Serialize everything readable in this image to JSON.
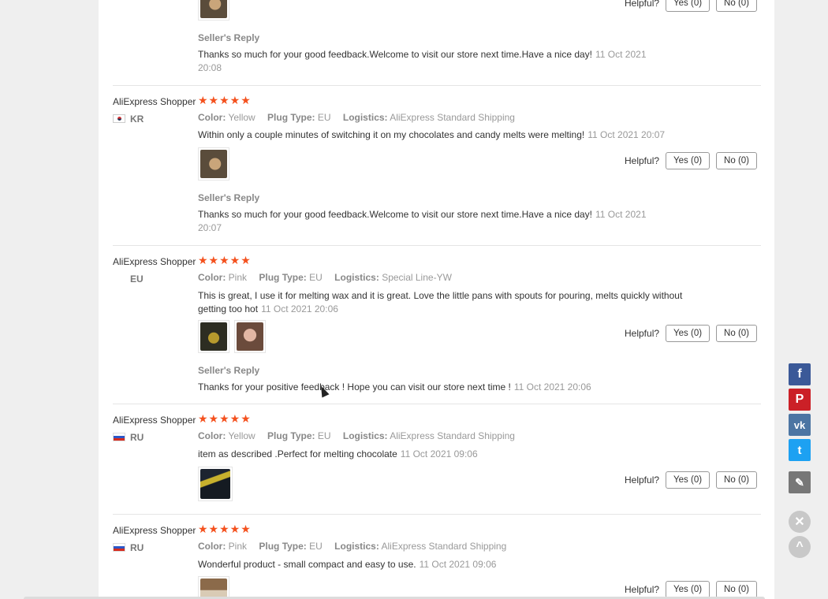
{
  "top_partial": {
    "helpful_label": "Helpful?",
    "yes_label": "Yes (0)",
    "no_label": "No (0)",
    "seller_title": "Seller's Reply",
    "seller_text": "Thanks so much for your good feedback.Welcome to visit our store next time.Have a nice day!",
    "seller_date": "11 Oct 2021 20:08"
  },
  "feedbacks": [
    {
      "user": "AliExpress Shopper",
      "country": "KR",
      "stars": "★★★★★",
      "color_label": "Color:",
      "color": "Yellow",
      "plug_label": "Plug Type:",
      "plug": "EU",
      "logistics_label": "Logistics:",
      "logistics": "AliExpress Standard Shipping",
      "text": "Within only a couple minutes of switching it on my chocolates and candy melts were melting!",
      "date": "11 Oct 2021 20:07",
      "helpful_label": "Helpful?",
      "yes_label": "Yes (0)",
      "no_label": "No (0)",
      "seller_title": "Seller's Reply",
      "seller_text": "Thanks so much for your good feedback.Welcome to visit our store next time.Have a nice day!",
      "seller_date": "11 Oct 2021 20:07"
    },
    {
      "user": "AliExpress Shopper",
      "country": "EU",
      "stars": "★★★★★",
      "color_label": "Color:",
      "color": "Pink",
      "plug_label": "Plug Type:",
      "plug": "EU",
      "logistics_label": "Logistics:",
      "logistics": "Special Line-YW",
      "text": "This is great, I use it for melting wax and it is great. Love the little pans with spouts for pouring, melts quickly without getting too hot",
      "date": "11 Oct 2021 20:06",
      "helpful_label": "Helpful?",
      "yes_label": "Yes (0)",
      "no_label": "No (0)",
      "seller_title": "Seller's Reply",
      "seller_text": "Thanks for your positive feedback ! Hope you can visit our store next time !",
      "seller_date": "11 Oct 2021 20:06"
    },
    {
      "user": "AliExpress Shopper",
      "country": "RU",
      "stars": "★★★★★",
      "color_label": "Color:",
      "color": "Yellow",
      "plug_label": "Plug Type:",
      "plug": "EU",
      "logistics_label": "Logistics:",
      "logistics": "AliExpress Standard Shipping",
      "text": "item as described .Perfect for melting chocolate",
      "date": "11 Oct 2021 09:06",
      "helpful_label": "Helpful?",
      "yes_label": "Yes (0)",
      "no_label": "No (0)"
    },
    {
      "user": "AliExpress Shopper",
      "country": "RU",
      "stars": "★★★★★",
      "color_label": "Color:",
      "color": "Pink",
      "plug_label": "Plug Type:",
      "plug": "EU",
      "logistics_label": "Logistics:",
      "logistics": "AliExpress Standard Shipping",
      "text": "Wonderful product - small compact and easy to use.",
      "date": "11 Oct 2021 09:06",
      "helpful_label": "Helpful?",
      "yes_label": "Yes (0)",
      "no_label": "No (0)"
    }
  ],
  "social": {
    "facebook_icon": "f",
    "pinterest_icon": "P",
    "vk_icon": "vk",
    "twitter_icon": "t",
    "edit_icon": "✎",
    "close_icon": "✕",
    "back_to_top_icon": "^"
  },
  "colors": {
    "star": "#f4511e",
    "facebook": "#3b5998",
    "pinterest": "#cb2027",
    "vk": "#4c75a3",
    "twitter": "#1da1f2"
  }
}
